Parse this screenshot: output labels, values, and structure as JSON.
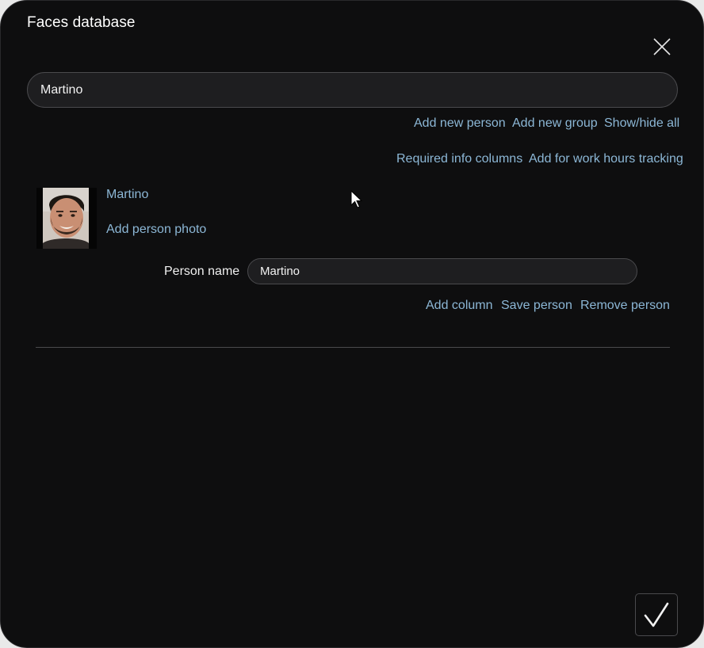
{
  "dialog": {
    "title": "Faces database"
  },
  "search": {
    "value": "Martino"
  },
  "actions": {
    "add_new_person": "Add new person",
    "add_new_group": "Add new group",
    "show_hide_all": "Show/hide all",
    "required_info_columns": "Required info columns",
    "add_for_work_hours_tracking": "Add for work hours tracking"
  },
  "person": {
    "name_link": "Martino",
    "add_photo": "Add person photo",
    "name_label": "Person name",
    "name_value": "Martino",
    "add_column": "Add column",
    "save_person": "Save person",
    "remove_person": "Remove person"
  },
  "colors": {
    "background": "#0e0e0f",
    "link": "#8cb7d6",
    "field": "#1e1e20",
    "border": "#4a4a4d"
  },
  "icons": {
    "close": "close-icon",
    "confirm": "checkmark-icon",
    "cursor": "mouse-pointer-icon"
  }
}
